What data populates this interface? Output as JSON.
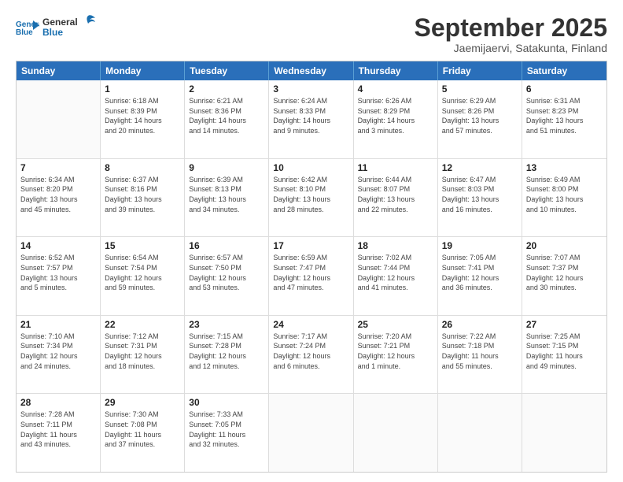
{
  "logo": {
    "line1": "General",
    "line2": "Blue"
  },
  "title": "September 2025",
  "location": "Jaemijaervi, Satakunta, Finland",
  "days_header": [
    "Sunday",
    "Monday",
    "Tuesday",
    "Wednesday",
    "Thursday",
    "Friday",
    "Saturday"
  ],
  "weeks": [
    [
      {
        "day": "",
        "text": ""
      },
      {
        "day": "1",
        "text": "Sunrise: 6:18 AM\nSunset: 8:39 PM\nDaylight: 14 hours\nand 20 minutes."
      },
      {
        "day": "2",
        "text": "Sunrise: 6:21 AM\nSunset: 8:36 PM\nDaylight: 14 hours\nand 14 minutes."
      },
      {
        "day": "3",
        "text": "Sunrise: 6:24 AM\nSunset: 8:33 PM\nDaylight: 14 hours\nand 9 minutes."
      },
      {
        "day": "4",
        "text": "Sunrise: 6:26 AM\nSunset: 8:29 PM\nDaylight: 14 hours\nand 3 minutes."
      },
      {
        "day": "5",
        "text": "Sunrise: 6:29 AM\nSunset: 8:26 PM\nDaylight: 13 hours\nand 57 minutes."
      },
      {
        "day": "6",
        "text": "Sunrise: 6:31 AM\nSunset: 8:23 PM\nDaylight: 13 hours\nand 51 minutes."
      }
    ],
    [
      {
        "day": "7",
        "text": "Sunrise: 6:34 AM\nSunset: 8:20 PM\nDaylight: 13 hours\nand 45 minutes."
      },
      {
        "day": "8",
        "text": "Sunrise: 6:37 AM\nSunset: 8:16 PM\nDaylight: 13 hours\nand 39 minutes."
      },
      {
        "day": "9",
        "text": "Sunrise: 6:39 AM\nSunset: 8:13 PM\nDaylight: 13 hours\nand 34 minutes."
      },
      {
        "day": "10",
        "text": "Sunrise: 6:42 AM\nSunset: 8:10 PM\nDaylight: 13 hours\nand 28 minutes."
      },
      {
        "day": "11",
        "text": "Sunrise: 6:44 AM\nSunset: 8:07 PM\nDaylight: 13 hours\nand 22 minutes."
      },
      {
        "day": "12",
        "text": "Sunrise: 6:47 AM\nSunset: 8:03 PM\nDaylight: 13 hours\nand 16 minutes."
      },
      {
        "day": "13",
        "text": "Sunrise: 6:49 AM\nSunset: 8:00 PM\nDaylight: 13 hours\nand 10 minutes."
      }
    ],
    [
      {
        "day": "14",
        "text": "Sunrise: 6:52 AM\nSunset: 7:57 PM\nDaylight: 13 hours\nand 5 minutes."
      },
      {
        "day": "15",
        "text": "Sunrise: 6:54 AM\nSunset: 7:54 PM\nDaylight: 12 hours\nand 59 minutes."
      },
      {
        "day": "16",
        "text": "Sunrise: 6:57 AM\nSunset: 7:50 PM\nDaylight: 12 hours\nand 53 minutes."
      },
      {
        "day": "17",
        "text": "Sunrise: 6:59 AM\nSunset: 7:47 PM\nDaylight: 12 hours\nand 47 minutes."
      },
      {
        "day": "18",
        "text": "Sunrise: 7:02 AM\nSunset: 7:44 PM\nDaylight: 12 hours\nand 41 minutes."
      },
      {
        "day": "19",
        "text": "Sunrise: 7:05 AM\nSunset: 7:41 PM\nDaylight: 12 hours\nand 36 minutes."
      },
      {
        "day": "20",
        "text": "Sunrise: 7:07 AM\nSunset: 7:37 PM\nDaylight: 12 hours\nand 30 minutes."
      }
    ],
    [
      {
        "day": "21",
        "text": "Sunrise: 7:10 AM\nSunset: 7:34 PM\nDaylight: 12 hours\nand 24 minutes."
      },
      {
        "day": "22",
        "text": "Sunrise: 7:12 AM\nSunset: 7:31 PM\nDaylight: 12 hours\nand 18 minutes."
      },
      {
        "day": "23",
        "text": "Sunrise: 7:15 AM\nSunset: 7:28 PM\nDaylight: 12 hours\nand 12 minutes."
      },
      {
        "day": "24",
        "text": "Sunrise: 7:17 AM\nSunset: 7:24 PM\nDaylight: 12 hours\nand 6 minutes."
      },
      {
        "day": "25",
        "text": "Sunrise: 7:20 AM\nSunset: 7:21 PM\nDaylight: 12 hours\nand 1 minute."
      },
      {
        "day": "26",
        "text": "Sunrise: 7:22 AM\nSunset: 7:18 PM\nDaylight: 11 hours\nand 55 minutes."
      },
      {
        "day": "27",
        "text": "Sunrise: 7:25 AM\nSunset: 7:15 PM\nDaylight: 11 hours\nand 49 minutes."
      }
    ],
    [
      {
        "day": "28",
        "text": "Sunrise: 7:28 AM\nSunset: 7:11 PM\nDaylight: 11 hours\nand 43 minutes."
      },
      {
        "day": "29",
        "text": "Sunrise: 7:30 AM\nSunset: 7:08 PM\nDaylight: 11 hours\nand 37 minutes."
      },
      {
        "day": "30",
        "text": "Sunrise: 7:33 AM\nSunset: 7:05 PM\nDaylight: 11 hours\nand 32 minutes."
      },
      {
        "day": "",
        "text": ""
      },
      {
        "day": "",
        "text": ""
      },
      {
        "day": "",
        "text": ""
      },
      {
        "day": "",
        "text": ""
      }
    ]
  ]
}
